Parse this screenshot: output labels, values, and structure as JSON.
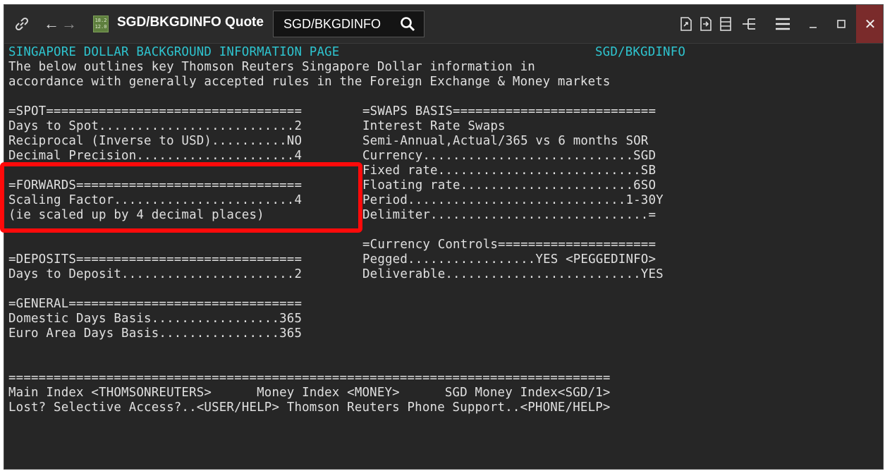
{
  "toolbar": {
    "app_title": "SGD/BKGDINFO Quote",
    "search_value": "SGD/BKGDINFO",
    "quote_icon_text_top": "18.2",
    "quote_icon_text_bottom": "12.0",
    "quote_icon_color": "#5e7f3e",
    "icons": [
      "link-icon",
      "back-arrow-icon",
      "forward-arrow-icon",
      "quote-icon",
      "search-icon",
      "export-icon",
      "export-alt-icon",
      "list-icon",
      "tree-icon",
      "menu-icon",
      "minimize-icon",
      "maximize-icon",
      "close-icon"
    ]
  },
  "page": {
    "header_title": "SINGAPORE DOLLAR BACKGROUND INFORMATION PAGE",
    "header_code": "SGD/BKGDINFO",
    "intro_1": "The below outlines key Thomson Reuters Singapore Dollar information in",
    "intro_2": "accordance with generally accepted rules in the Foreign Exchange & Money markets",
    "spot_header": "=SPOT==================================",
    "spot_days": "Days to Spot..........................2",
    "spot_reciprocal": "Reciprocal (Inverse to USD)..........NO",
    "spot_decimal": "Decimal Precision.....................4",
    "fwd_header": "=FORWARDS==============================",
    "fwd_scaling": "Scaling Factor........................4",
    "fwd_note": "(ie scaled up by 4 decimal places)",
    "dep_header": "=DEPOSITS==============================",
    "dep_days": "Days to Deposit.......................2",
    "gen_header": "=GENERAL===============================",
    "gen_domestic": "Domestic Days Basis.................365",
    "gen_euro": "Euro Area Days Basis................365",
    "swaps_header": "=SWAPS BASIS===========================",
    "swaps_irs": "Interest Rate Swaps",
    "swaps_semi": "Semi-Annual,Actual/365 vs 6 months SOR",
    "swaps_currency": "Currency............................SGD",
    "swaps_fixed": "Fixed rate...........................SB",
    "swaps_floating": "Floating rate.......................6SO",
    "swaps_period": "Period.............................1-30Y",
    "swaps_delimiter": "Delimiter.............................=",
    "cc_header": "=Currency Controls=====================",
    "cc_pegged": "Pegged.................YES <PEGGEDINFO>",
    "cc_deliverable": "Deliverable..........................YES",
    "footer_rule": "================================================================================",
    "footer_1": "Main Index <THOMSONREUTERS>      Money Index <MONEY>      SGD Money Index<SGD/1>",
    "footer_2": "Lost? Selective Access?..<USER/HELP> Thomson Reuters Phone Support..<PHONE/HELP>"
  },
  "colors": {
    "header_text": "#2ec4cf",
    "body_text": "#e0e0e0",
    "background": "#262626",
    "highlight_box": "#ff0a0a"
  }
}
